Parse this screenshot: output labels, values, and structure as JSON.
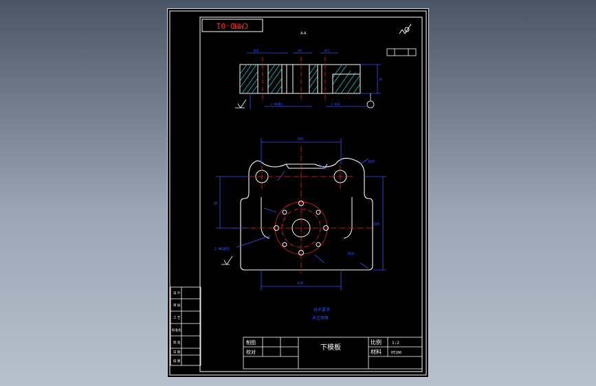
{
  "colors": {
    "background_top": "#4a5566",
    "background_bottom": "#b7c1cd",
    "paper": "#000000",
    "frame": "#ffffff",
    "dimension": "#3050ff",
    "centerline": "#ff2020",
    "hatch": "#00c8c8",
    "geometry": "#ffffff",
    "label": "#ffffff"
  },
  "drawing": {
    "code_block": "CMMD-01",
    "title_block": {
      "name_label": "制图",
      "check_label": "校对",
      "part_name": "下模板",
      "scale_label": "比例",
      "scale_value": "1:2",
      "material_label": "材料",
      "material_value": "HT200"
    },
    "notes": {
      "note_line1": "技术要求",
      "note_line2": "未注倒角"
    },
    "dimensions": {
      "width_top": "160",
      "width_bottom": "120",
      "height_left": "85",
      "height_right": "100",
      "radius_top_right": "R20",
      "radius_bottom_right": "R10",
      "hole_callout": "2-Φ8通孔"
    },
    "side_panel": {
      "rows": [
        "设 计",
        "审 核",
        "工 艺",
        "标准化",
        "批 准",
        "日 期",
        "描 图"
      ]
    },
    "section_label": "A-A"
  }
}
